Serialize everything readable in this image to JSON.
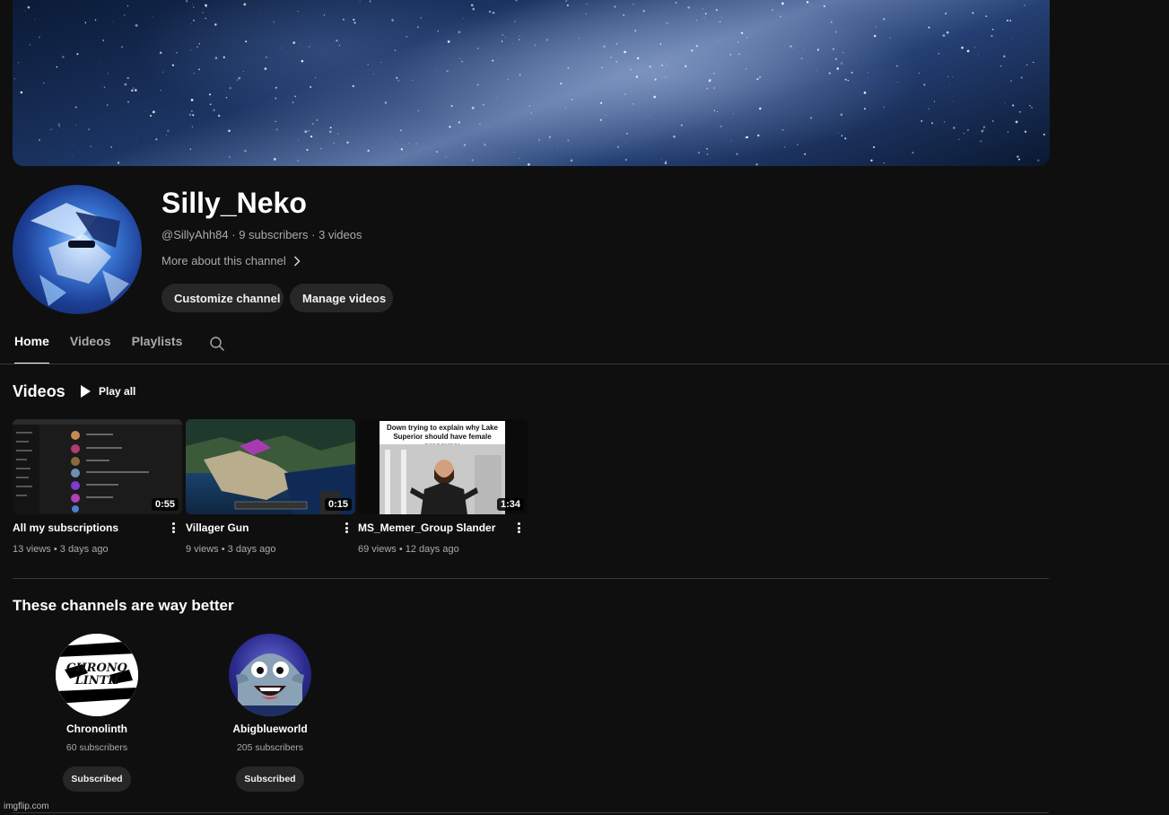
{
  "channel": {
    "name": "Silly_Neko",
    "handle": "@SillyAhh84",
    "subscribers": "9 subscribers",
    "video_count": "3 videos",
    "meta_separator": " · ",
    "more_about": "More about this channel",
    "customize_label": "Customize channel",
    "manage_label": "Manage videos"
  },
  "tabs": [
    "Home",
    "Videos",
    "Playlists"
  ],
  "active_tab": "Home",
  "videos_section": {
    "title": "Videos",
    "play_all": "Play all",
    "items": [
      {
        "title": "All my subscriptions",
        "views": "13 views",
        "age": "3 days ago",
        "duration": "0:55"
      },
      {
        "title": "Villager Gun",
        "views": "9 views",
        "age": "3 days ago",
        "duration": "0:15"
      },
      {
        "title": "MS_Memer_Group Slander",
        "views": "69 views",
        "age": "12 days ago",
        "duration": "1:34",
        "thumb_caption": "Down trying to explain why Lake Superior should have female pronouns:"
      }
    ]
  },
  "channels_section": {
    "title": "These channels are way better",
    "items": [
      {
        "name": "Chronolinth",
        "subscribers": "60 subscribers",
        "button": "Subscribed",
        "logo_text": "CHRONO LINTH"
      },
      {
        "name": "Abigblueworld",
        "subscribers": "205 subscribers",
        "button": "Subscribed"
      }
    ]
  },
  "watermark": "imgflip.com",
  "colors": {
    "background": "#0f0f0f",
    "pill": "#272727",
    "secondary_text": "#aaaaaa"
  }
}
